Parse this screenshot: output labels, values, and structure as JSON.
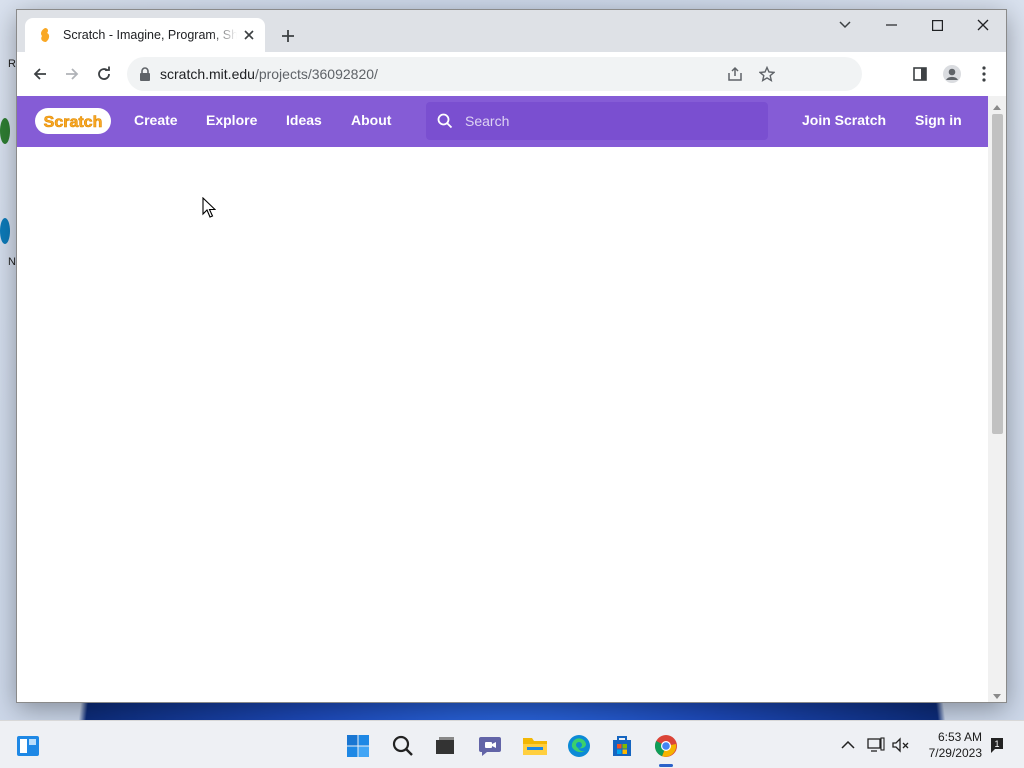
{
  "browser": {
    "tab_title": "Scratch - Imagine, Program, Share",
    "url_host": "scratch.mit.edu",
    "url_path": "/projects/36092820/"
  },
  "page": {
    "nav": {
      "logo_text": "Scratch",
      "links": [
        "Create",
        "Explore",
        "Ideas",
        "About"
      ],
      "search_placeholder": "Search",
      "join": "Join Scratch",
      "signin": "Sign in"
    },
    "colors": {
      "nav_bg": "#855cd6",
      "search_bg": "#7a4fd0",
      "logo_fill": "#f9a825"
    }
  },
  "desktop": {
    "icon_letters": [
      "R",
      "N"
    ]
  },
  "taskbar": {
    "apps": [
      "start",
      "search",
      "task-view",
      "teams-chat",
      "file-explorer",
      "edge",
      "store",
      "chrome"
    ],
    "time": "6:53 AM",
    "date": "7/29/2023"
  }
}
